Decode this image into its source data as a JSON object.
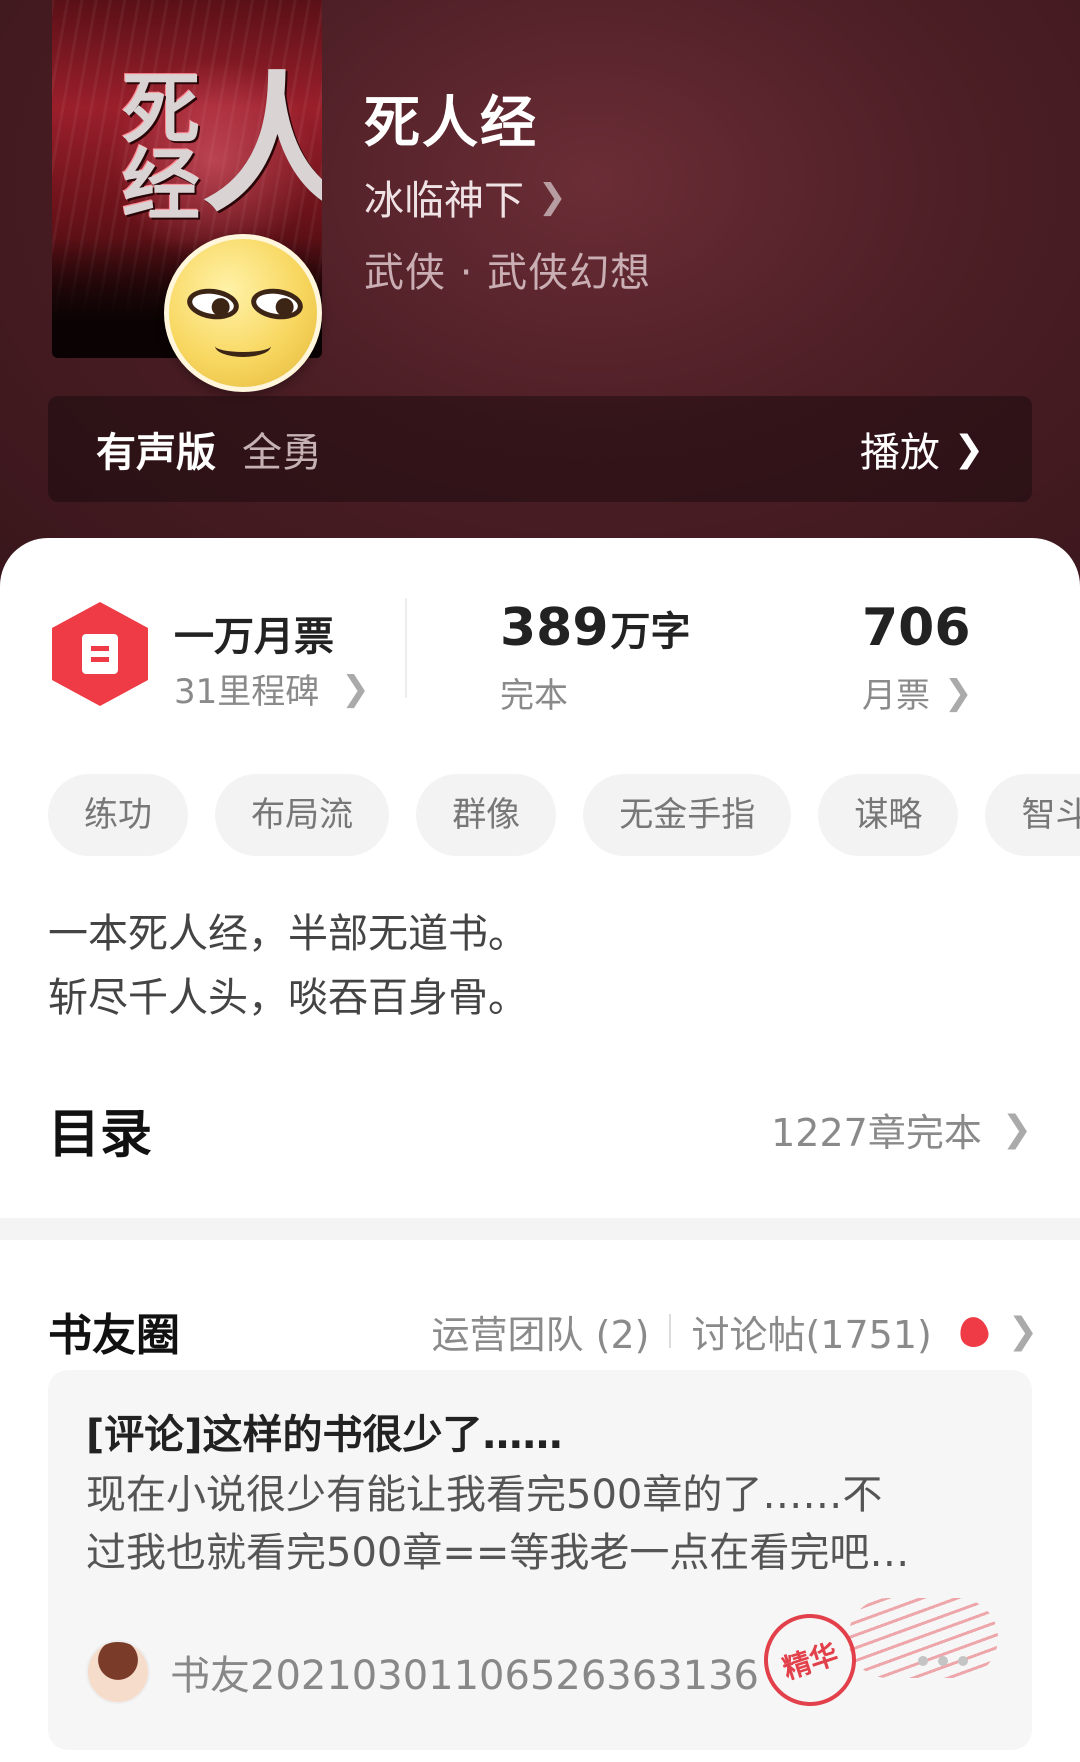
{
  "book": {
    "title": "死人经",
    "author": "冰临神下",
    "genre": "武侠 · 武侠幻想",
    "cover_text_small": "死经",
    "cover_text_large": "人"
  },
  "audio": {
    "label": "有声版",
    "narrator": "全勇",
    "play_label": "播放"
  },
  "stats": {
    "tickets_title": "一万月票",
    "milestones": "31里程碑",
    "word_count": "389",
    "word_unit": "万字",
    "status": "完本",
    "monthly_votes": "706",
    "monthly_votes_label": "月票"
  },
  "tags": [
    "练功",
    "布局流",
    "群像",
    "无金手指",
    "谋略",
    "智斗"
  ],
  "intro": {
    "line1": "一本死人经，半部无道书。",
    "line2": "斩尽千人头，啖吞百身骨。"
  },
  "toc": {
    "title": "目录",
    "meta": "1227章完本"
  },
  "circle": {
    "title": "书友圈",
    "team": "运营团队 (2)",
    "posts": "讨论帖(1751)"
  },
  "post": {
    "title": "[评论]这样的书很少了……",
    "body_line1": "现在小说很少有能让我看完500章的了……不",
    "body_line2": "过我也就看完500章==等我老一点在看完吧…",
    "user": "书友20210301106526363136",
    "stamp": "精华"
  },
  "icons": {
    "chevron": "chevron-right-icon",
    "ticket": "ticket-icon",
    "flame": "flame-icon"
  },
  "colors": {
    "accent": "#ee3b45",
    "hero_bg": "#4c1e25"
  }
}
